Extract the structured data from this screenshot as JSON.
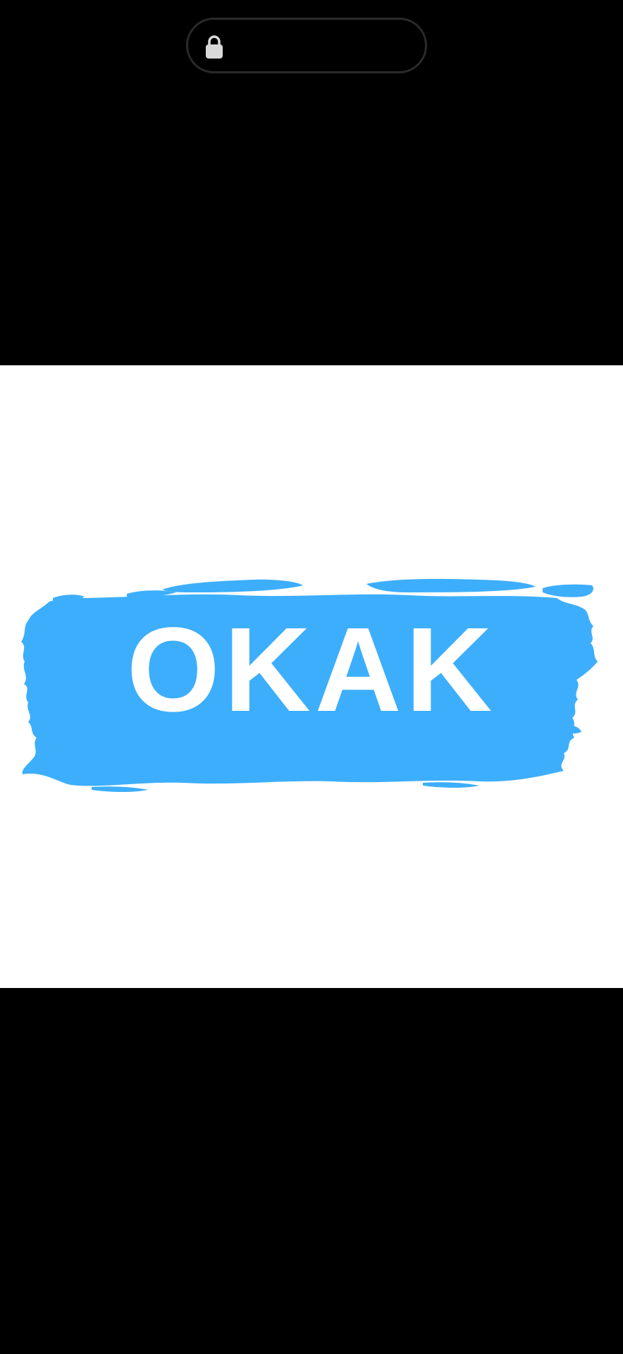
{
  "status_pill": {
    "icon": "lock-icon"
  },
  "media": {
    "logo_text": "OKAK",
    "brush_color": "#3daefb",
    "text_color": "#ffffff",
    "background_color": "#ffffff"
  },
  "colors": {
    "screen_background": "#000000",
    "pill_border": "#2a2a2a",
    "lock_fill": "#d9d9d9"
  }
}
